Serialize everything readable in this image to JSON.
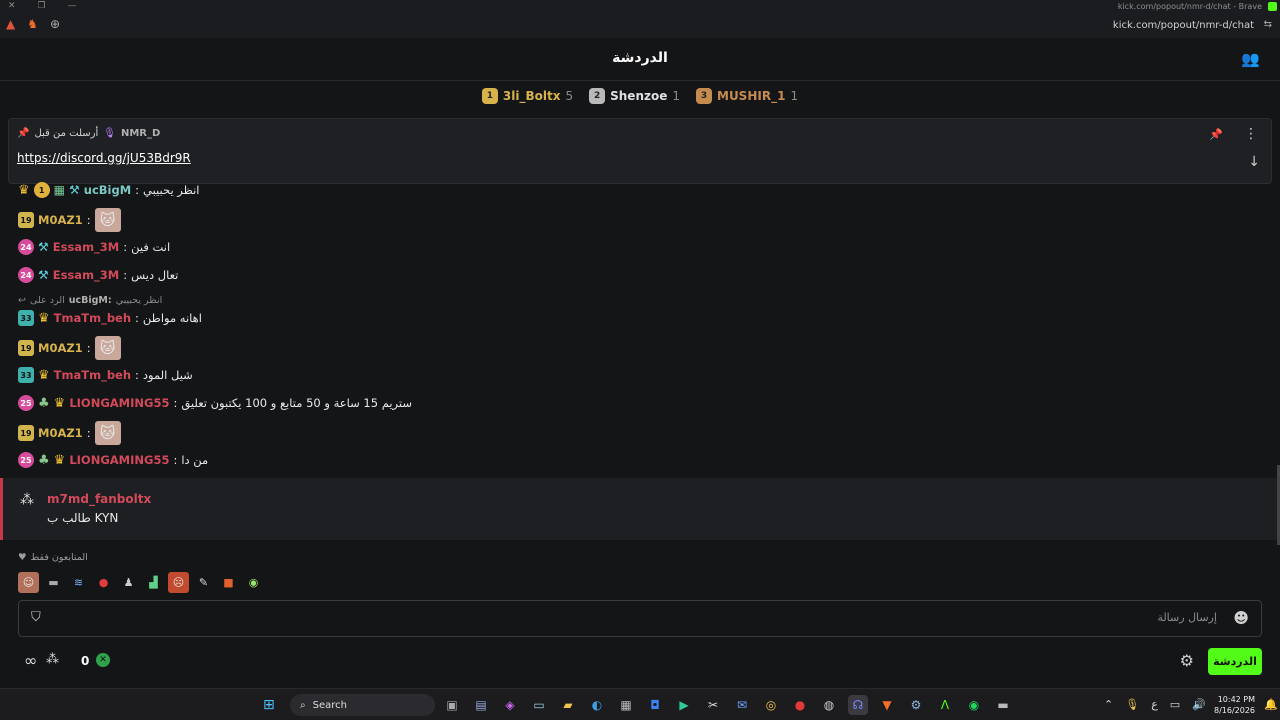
{
  "browser": {
    "window_title": "kick.com/popout/nmr-d/chat - Brave",
    "url": "kick.com/popout/nmr-d/chat"
  },
  "header": {
    "title": "الدردشة"
  },
  "leaderboard": [
    {
      "rank": "1",
      "name": "3li_Boltx",
      "count": "5",
      "name_color": "#d8b24a",
      "badge_color": "#d8b24a"
    },
    {
      "rank": "2",
      "name": "Shenzoe",
      "count": "1",
      "name_color": "#e0e0e0",
      "badge_color": "#b9b9b9"
    },
    {
      "rank": "3",
      "name": "MUSHIR_1",
      "count": "1",
      "name_color": "#c58b4f",
      "badge_color": "#c58b4f"
    }
  ],
  "pinned": {
    "label": "أرسلت من قبل",
    "user": "NMR_D",
    "link": "https://discord.gg/jU53Bdr9R"
  },
  "messages": [
    {
      "user": "ucBigM",
      "sep": ":",
      "text": "انظر يحبيبي",
      "color": "#7ac9c3"
    },
    {
      "user": "M0AZ1",
      "sep": ":",
      "text": "",
      "color": "#d8b24a"
    },
    {
      "user": "Essam_3M",
      "sep": ":",
      "text": "انت فين",
      "color": "#d24a5a"
    },
    {
      "user": "Essam_3M",
      "sep": ":",
      "text": "تعال ديس",
      "color": "#d24a5a"
    },
    {
      "user": "TmaTm_beh",
      "sep": ":",
      "text": "اهانه مواطن",
      "color": "#d24a5a"
    },
    {
      "user": "M0AZ1",
      "sep": ":",
      "text": "",
      "color": "#d8b24a"
    },
    {
      "user": "TmaTm_beh",
      "sep": ":",
      "text": "شيل المود",
      "color": "#d24a5a"
    },
    {
      "user": "LIONGAMING55",
      "sep": ":",
      "text": "ستريم 15 ساعة و 50 متابع و 100 يكتبون تعليق",
      "color": "#d24a5a"
    },
    {
      "user": "M0AZ1",
      "sep": ":",
      "text": "",
      "color": "#d8b24a"
    },
    {
      "user": "LIONGAMING55",
      "sep": ":",
      "text": "من دا",
      "color": "#d24a5a"
    }
  ],
  "badges": {
    "lvl19": "19",
    "lvl24": "24",
    "lvl33": "33",
    "lvl25": "25",
    "gold1": "1"
  },
  "reply": {
    "prefix": "الرد على",
    "user": "ucBigM:",
    "text": "انظر يحبيبي"
  },
  "highlight": {
    "user": "m7md_fanboltx",
    "text": "طالب ب KYN"
  },
  "emotes": {
    "label": "المتابعون فقط"
  },
  "input": {
    "placeholder": "إرسال رسالة"
  },
  "footer": {
    "count": "0",
    "send_label": "الدردشة"
  },
  "taskbar": {
    "search": "Search",
    "time": "10:42 PM",
    "date": "8/16/2026",
    "lang": "ع"
  }
}
